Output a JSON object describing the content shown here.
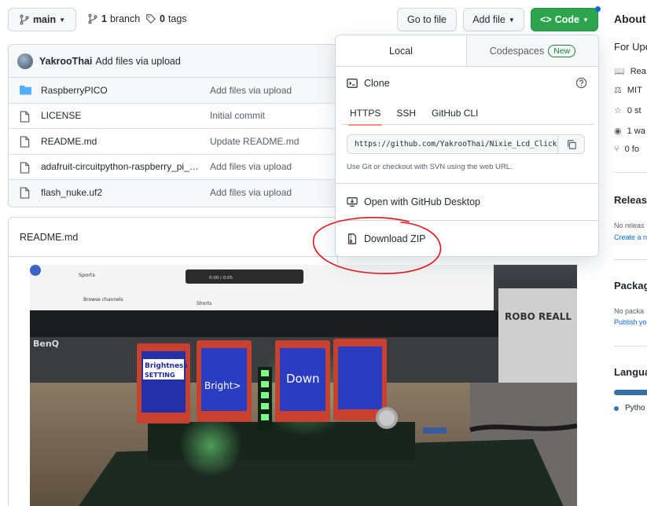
{
  "toolbar": {
    "branch_label": "main",
    "branches_count": "1",
    "branches_label": "branch",
    "tags_count": "0",
    "tags_label": "tags",
    "go_to_file": "Go to file",
    "add_file": "Add file",
    "code": "Code"
  },
  "commit": {
    "author": "YakrooThai",
    "message": "Add files via upload"
  },
  "files": [
    {
      "type": "folder",
      "name": "RaspberryPICO",
      "commit": "Add files via upload"
    },
    {
      "type": "file",
      "name": "LICENSE",
      "commit": "Initial commit"
    },
    {
      "type": "file",
      "name": "README.md",
      "commit": "Update README.md"
    },
    {
      "type": "file",
      "name": "adafruit-circuitpython-raspberry_pi_p...",
      "commit": "Add files via upload"
    },
    {
      "type": "file",
      "name": "flash_nuke.uf2",
      "commit": "Add files via upload"
    }
  ],
  "readme": {
    "title": "README.md",
    "photo": {
      "screen_sports": "Sports",
      "screen_browse": "Browse channels",
      "screen_shorts": "Shorts",
      "screen_time": "0:00 / 0:05",
      "monitor_brand": "BenQ",
      "poster_text": "ROBO REALL",
      "lcd1_line1": "Brightness",
      "lcd1_line2": "SETTING",
      "lcd2": "Bright>",
      "lcd3": "Down"
    }
  },
  "dropdown": {
    "tab_local": "Local",
    "tab_codespaces": "Codespaces",
    "badge_new": "New",
    "clone_label": "Clone",
    "protocols": [
      "HTTPS",
      "SSH",
      "GitHub CLI"
    ],
    "url": "https://github.com/YakrooThai/Nixie_Lcd_Click",
    "hint": "Use Git or checkout with SVN using the web URL.",
    "open_desktop": "Open with GitHub Desktop",
    "download_zip": "Download ZIP"
  },
  "sidebar": {
    "about_title": "About",
    "description": "For Upd",
    "links": [
      {
        "icon": "book-icon",
        "label": "Rea"
      },
      {
        "icon": "law-icon",
        "label": "MIT"
      },
      {
        "icon": "star-icon",
        "label": "0 st"
      },
      {
        "icon": "eye-icon",
        "label": "1 wa"
      },
      {
        "icon": "fork-icon",
        "label": "0 fo"
      }
    ],
    "releases_title": "Release",
    "releases_none": "No releas",
    "releases_create": "Create a n",
    "packages_title": "Packag",
    "packages_none": "No packa",
    "packages_publish": "Publish yo",
    "languages_title": "Langua",
    "language_name": "Pytho"
  },
  "colors": {
    "green_button": "#2da44e",
    "annotation_red": "#e0141b",
    "link_blue": "#0969da",
    "python_blue": "#3572A5",
    "folder_blue": "#54aeff"
  }
}
